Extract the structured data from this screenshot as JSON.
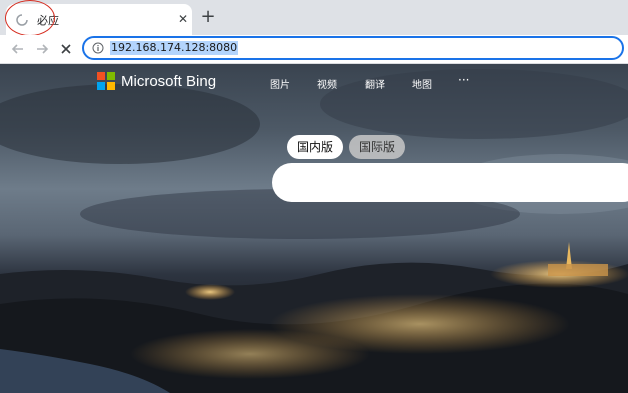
{
  "browser": {
    "tab": {
      "title": "必应"
    },
    "address_bar": {
      "url": "192.168.174.128:8080"
    }
  },
  "bing": {
    "brand": "Microsoft Bing",
    "nav": [
      "图片",
      "视频",
      "翻译",
      "地图"
    ],
    "more": "···",
    "region_toggle": {
      "domestic": "国内版",
      "international": "国际版",
      "selected": "domestic"
    },
    "logo_colors": [
      "#f25022",
      "#7fba00",
      "#00a4ef",
      "#ffb900"
    ]
  }
}
